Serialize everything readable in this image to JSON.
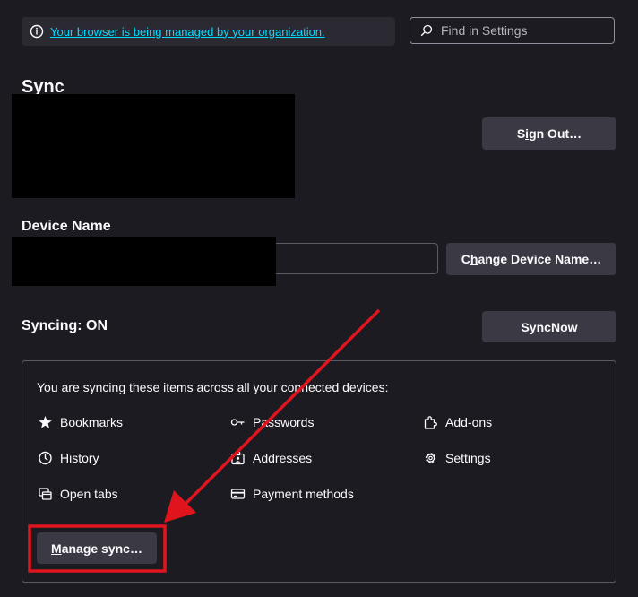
{
  "managed": {
    "text": "Your browser is being managed by your organization."
  },
  "search": {
    "placeholder": "Find in Settings"
  },
  "sync": {
    "title": "Sync",
    "sign_out_pre": "S",
    "sign_out_mn": "i",
    "sign_out_post": "gn Out…",
    "device_name_label": "Device Name",
    "change_pre": "C",
    "change_mn": "h",
    "change_post": "ange Device Name…",
    "status": "Syncing: ON",
    "sync_now_pre": "Sync ",
    "sync_now_mn": "N",
    "sync_now_post": "ow",
    "description": "You are syncing these items across all your connected devices:",
    "items": [
      {
        "label": "Bookmarks",
        "icon": "star-icon"
      },
      {
        "label": "Passwords",
        "icon": "key-icon"
      },
      {
        "label": "Add-ons",
        "icon": "puzzle-icon"
      },
      {
        "label": "History",
        "icon": "clock-icon"
      },
      {
        "label": "Addresses",
        "icon": "address-card-icon"
      },
      {
        "label": "Settings",
        "icon": "gear-icon"
      },
      {
        "label": "Open tabs",
        "icon": "tabs-icon"
      },
      {
        "label": "Payment methods",
        "icon": "credit-card-icon"
      }
    ],
    "manage_mn": "M",
    "manage_post": "anage sync…"
  },
  "colors": {
    "background": "#1c1b22",
    "button": "#3a3944",
    "link": "#00ddff",
    "annotation": "#e0141c"
  }
}
